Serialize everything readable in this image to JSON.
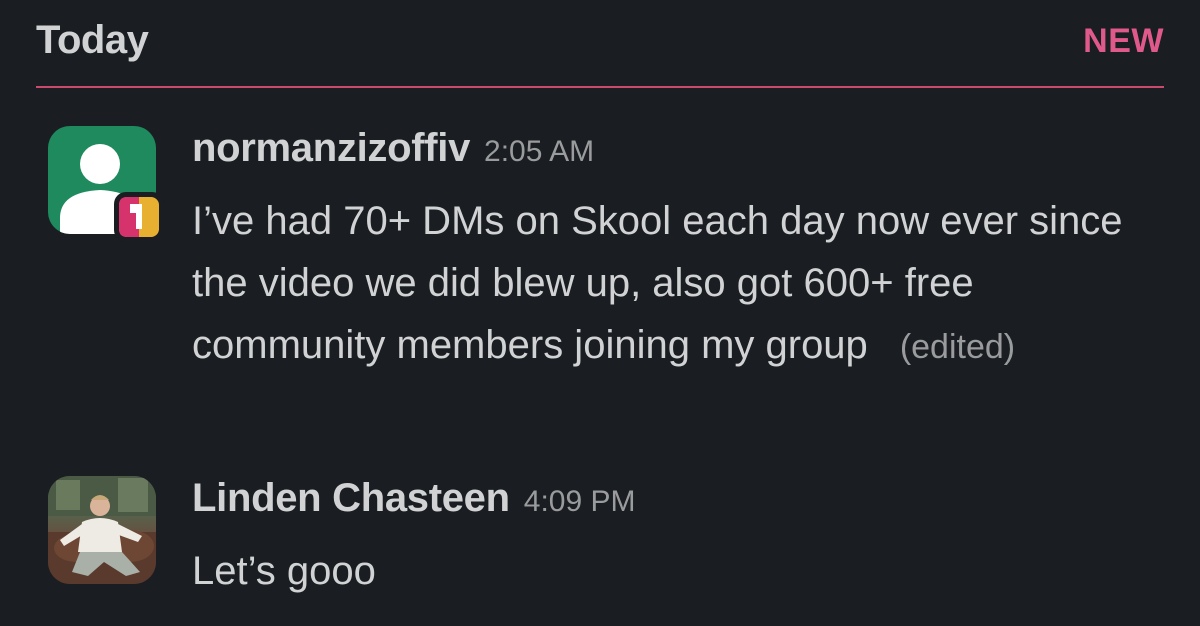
{
  "header": {
    "day_label": "Today",
    "new_label": "NEW"
  },
  "messages": [
    {
      "author": "normanzizoffiv",
      "time": "2:05 AM",
      "text": "I’ve had 70+ DMs on Skool each day now ever since the video we did blew up, also got 600+ free community members joining my group",
      "edited_label": "(edited)",
      "avatar_icon": "default-user-avatar-icon",
      "badge_icon": "external-member-badge-icon"
    },
    {
      "author": "Linden Chasteen",
      "time": "4:09 PM",
      "text": "Let’s gooo",
      "avatar_icon": "user-photo-avatar"
    }
  ],
  "colors": {
    "background": "#1a1d21",
    "new_divider": "#c94a6d",
    "new_label": "#e0598b",
    "avatar_green": "#1f8a5e"
  }
}
